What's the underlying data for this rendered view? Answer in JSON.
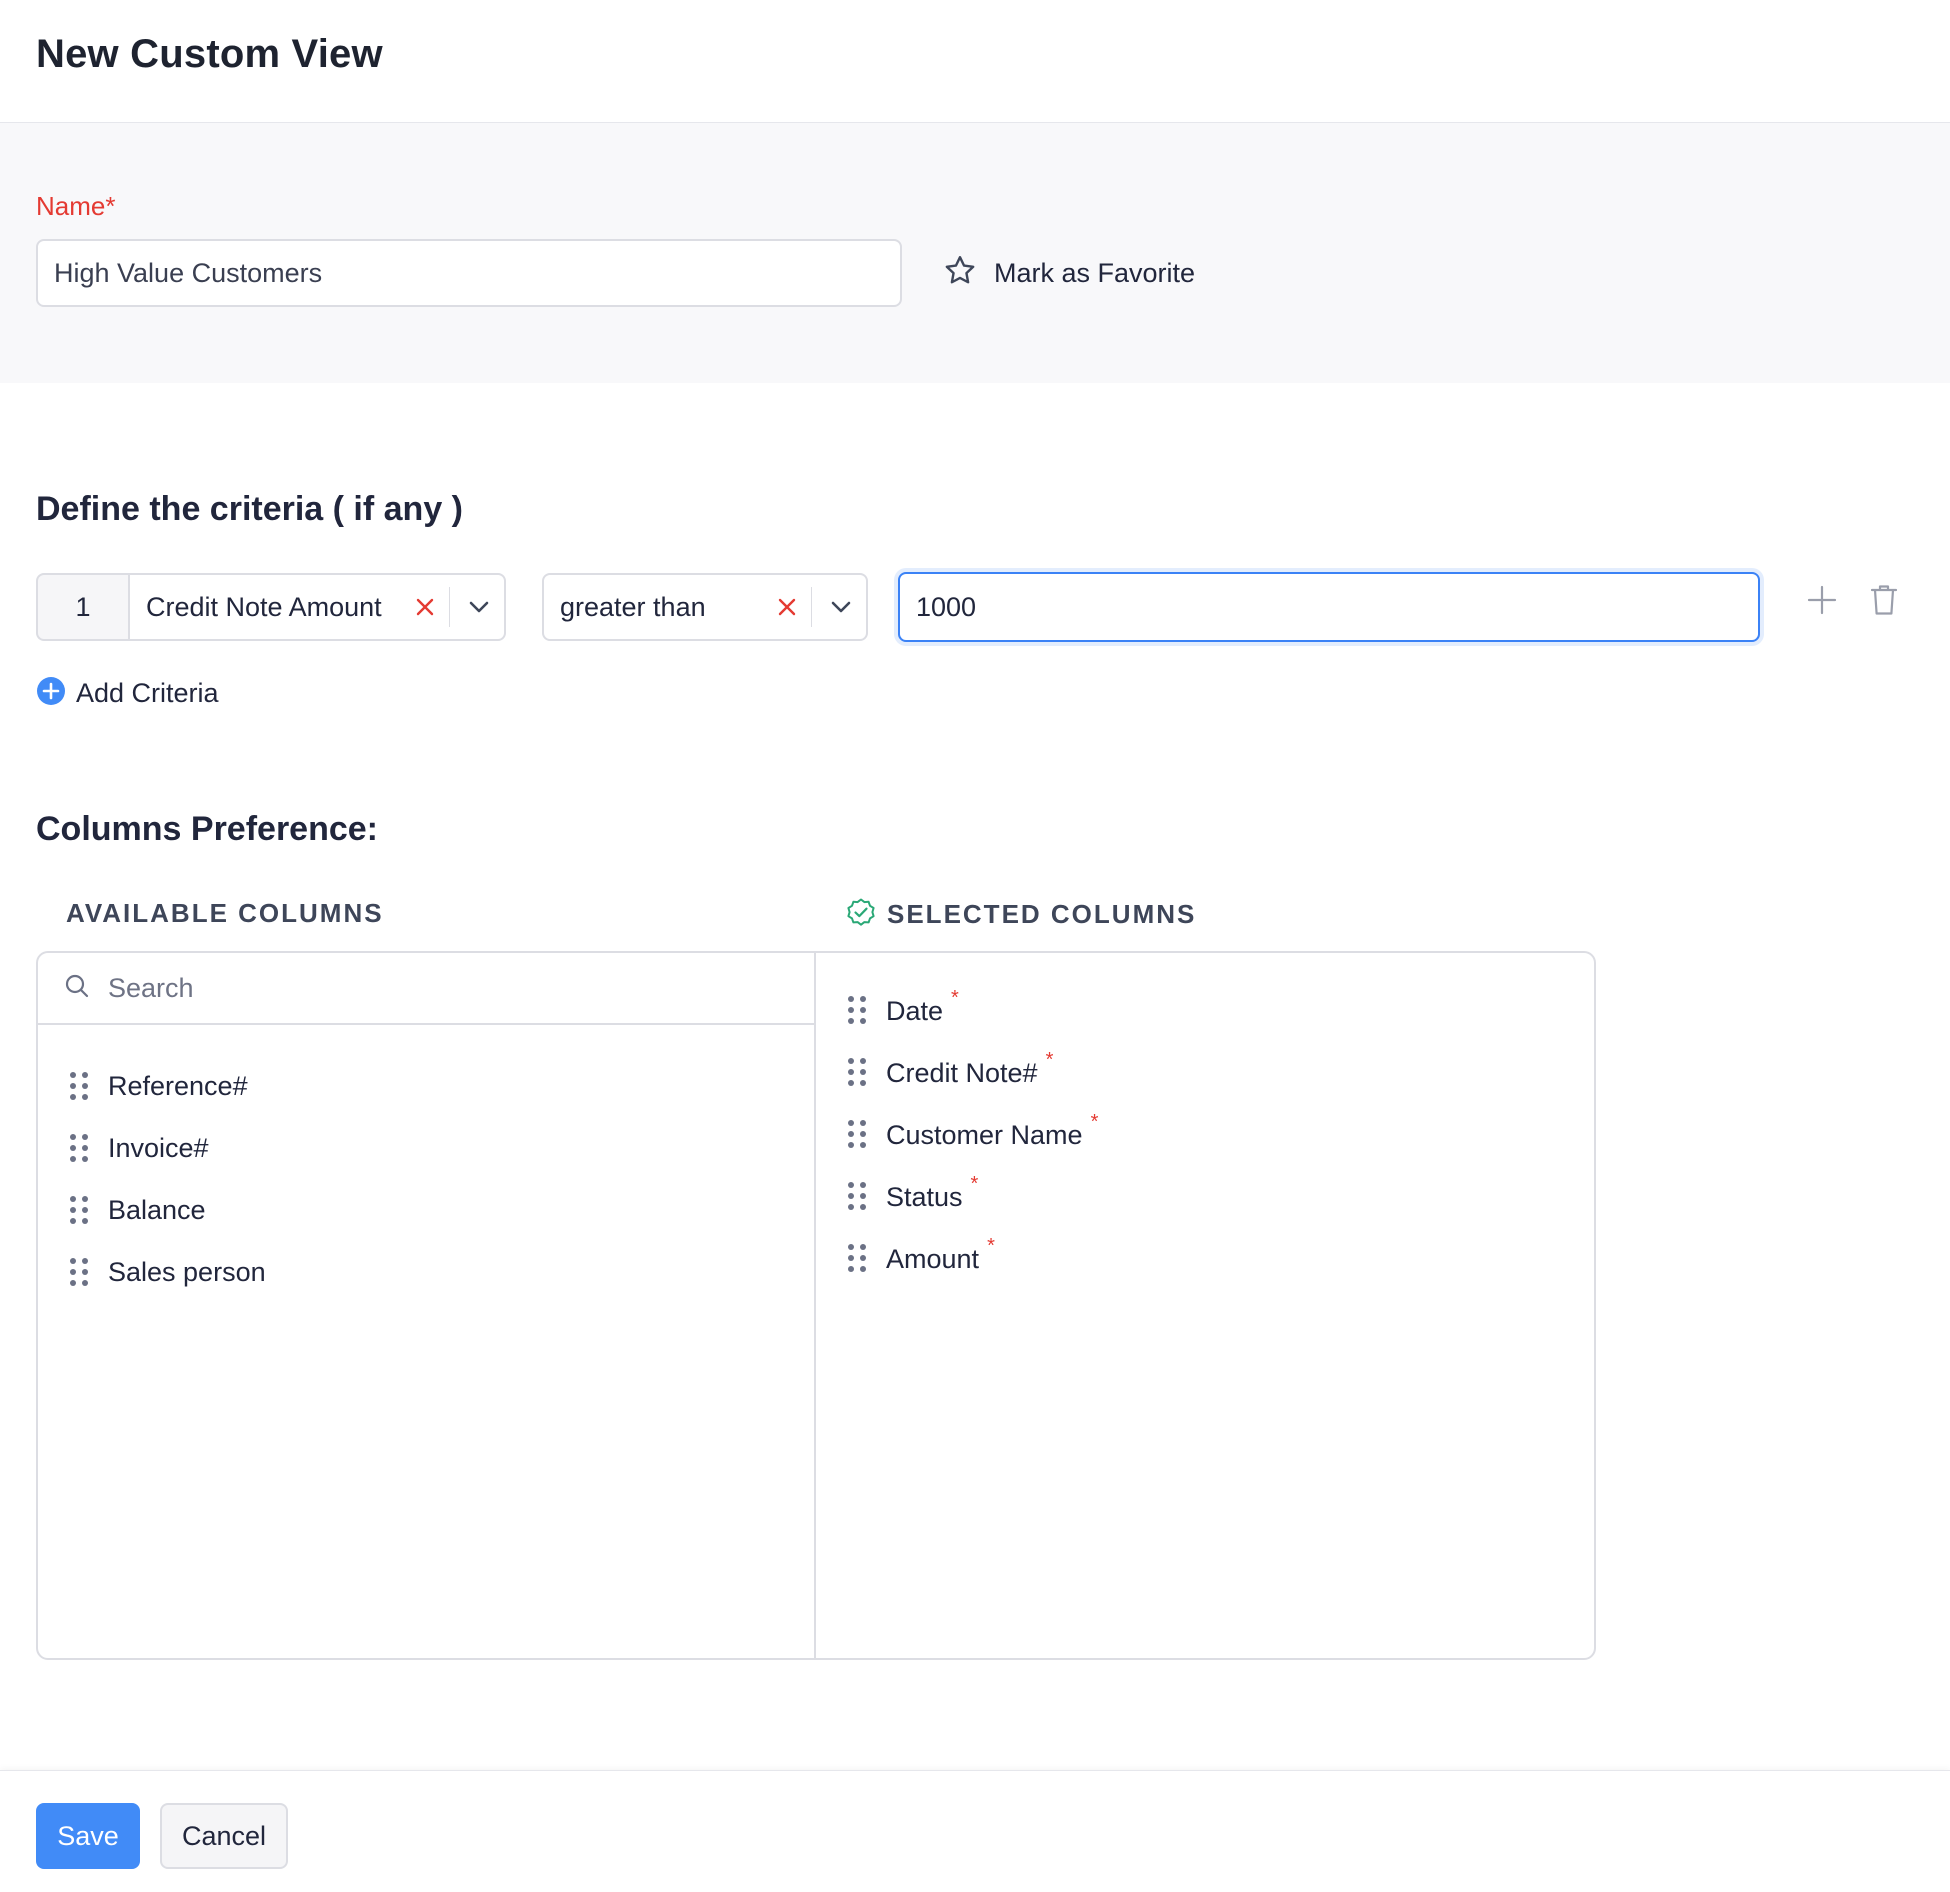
{
  "page": {
    "title": "New Custom View"
  },
  "name_section": {
    "label": "Name*",
    "value": "High Value Customers",
    "favorite_label": "Mark as Favorite"
  },
  "criteria": {
    "title": "Define the criteria ( if any )",
    "rows": [
      {
        "index": "1",
        "field": "Credit Note Amount",
        "operator": "greater than",
        "value": "1000"
      }
    ],
    "add_label": "Add Criteria"
  },
  "columns": {
    "title": "Columns Preference:",
    "available_header": "AVAILABLE COLUMNS",
    "selected_header": "SELECTED COLUMNS",
    "search_placeholder": "Search",
    "available": [
      "Reference#",
      "Invoice#",
      "Balance",
      "Sales person"
    ],
    "selected": [
      "Date",
      "Credit Note#",
      "Customer Name",
      "Status",
      "Amount"
    ],
    "required_marker": "*"
  },
  "footer": {
    "save_label": "Save",
    "cancel_label": "Cancel"
  },
  "colors": {
    "accent": "#418bf7",
    "required": "#e43a32",
    "selected_icon": "#2aa876"
  }
}
